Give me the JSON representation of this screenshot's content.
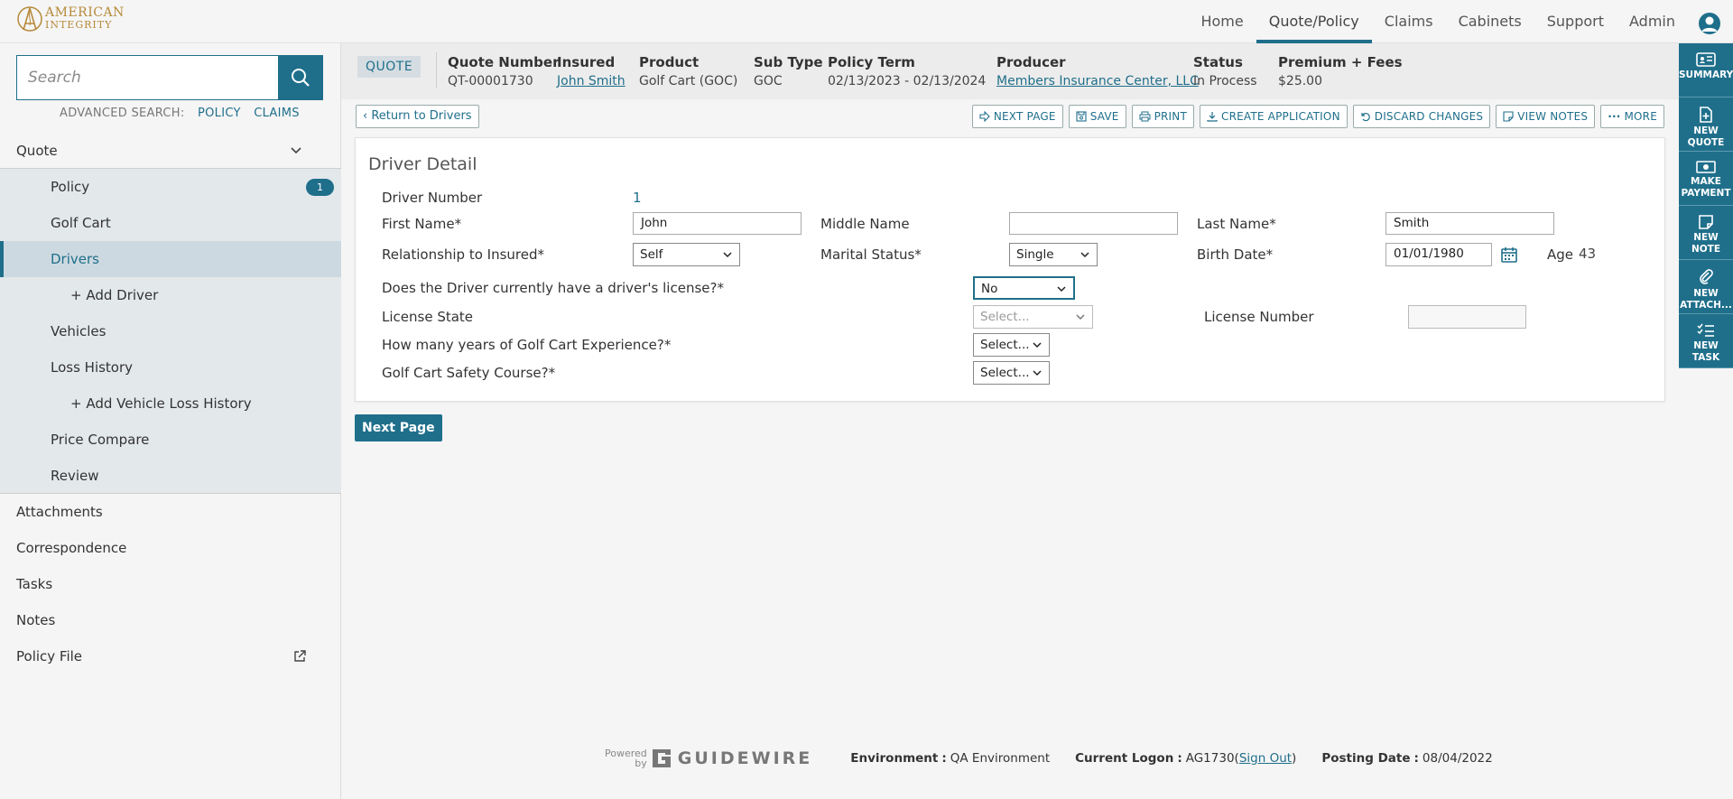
{
  "brand": {
    "line1": "AMERICAN",
    "line2": "INTEGRITY"
  },
  "topnav": [
    "Home",
    "Quote/Policy",
    "Claims",
    "Cabinets",
    "Support",
    "Admin"
  ],
  "search": {
    "placeholder": "Search",
    "adv_label": "ADVANCED SEARCH:",
    "policy": "POLICY",
    "claims": "CLAIMS"
  },
  "sidebar": {
    "quote": "Quote",
    "policy": "Policy",
    "policy_badge": "1",
    "golf_cart": "Golf Cart",
    "drivers": "Drivers",
    "add_driver": "+ Add Driver",
    "vehicles": "Vehicles",
    "loss_history": "Loss History",
    "add_vehicle_loss": "+ Add Vehicle Loss History",
    "price_compare": "Price Compare",
    "review": "Review",
    "attachments": "Attachments",
    "correspondence": "Correspondence",
    "tasks": "Tasks",
    "notes": "Notes",
    "policy_file": "Policy File"
  },
  "rail": [
    {
      "label1": "SUMMARY",
      "label2": ""
    },
    {
      "label1": "NEW",
      "label2": "QUOTE"
    },
    {
      "label1": "MAKE",
      "label2": "PAYMENT"
    },
    {
      "label1": "NEW",
      "label2": "NOTE"
    },
    {
      "label1": "NEW",
      "label2": "ATTACH..."
    },
    {
      "label1": "NEW",
      "label2": "TASK"
    }
  ],
  "header": {
    "tag": "QUOTE",
    "quote_number_label": "Quote Number",
    "quote_number": "QT-00001730",
    "insured_label": "Insured",
    "insured": "John Smith",
    "product_label": "Product",
    "product": "Golf Cart (GOC)",
    "subtype_label": "Sub Type",
    "subtype": "GOC",
    "term_label": "Policy Term",
    "term": "02/13/2023 - 02/13/2024",
    "producer_label": "Producer",
    "producer": "Members Insurance Center, LLC",
    "status_label": "Status",
    "status": "In Process",
    "premium_label": "Premium + Fees",
    "premium": "$25.00"
  },
  "toolbar": {
    "back": "Return to Drivers",
    "next_page": "NEXT PAGE",
    "save": "SAVE",
    "print": "PRINT",
    "create_app": "CREATE APPLICATION",
    "discard": "DISCARD CHANGES",
    "view_notes": "VIEW NOTES",
    "more": "MORE"
  },
  "form": {
    "title": "Driver Detail",
    "driver_number_label": "Driver Number",
    "driver_number": "1",
    "first_name_label": "First Name*",
    "first_name": "John",
    "middle_name_label": "Middle Name",
    "middle_name": "",
    "last_name_label": "Last Name*",
    "last_name": "Smith",
    "relationship_label": "Relationship to Insured*",
    "relationship": "Self",
    "marital_label": "Marital Status*",
    "marital": "Single",
    "birth_label": "Birth Date*",
    "birth": "01/01/1980",
    "age_label": "Age",
    "age": "43",
    "license_q_label": "Does the Driver currently have a driver's license?*",
    "license_q": "No",
    "license_state_label": "License State",
    "license_state": "Select...",
    "license_number_label": "License Number",
    "license_number": "",
    "experience_label": "How many years of Golf Cart Experience?*",
    "experience": "Select...",
    "safety_label": "Golf Cart Safety Course?*",
    "safety": "Select..."
  },
  "next_button": "Next Page",
  "footer": {
    "powered": "Powered",
    "by": "by",
    "gw": "GUIDEWIRE",
    "env_label": "Environment",
    "env": "QA Environment",
    "logon_label": "Current Logon",
    "logon": "AG1730",
    "signout": "Sign Out",
    "posting_label": "Posting Date",
    "posting": "08/04/2022"
  }
}
